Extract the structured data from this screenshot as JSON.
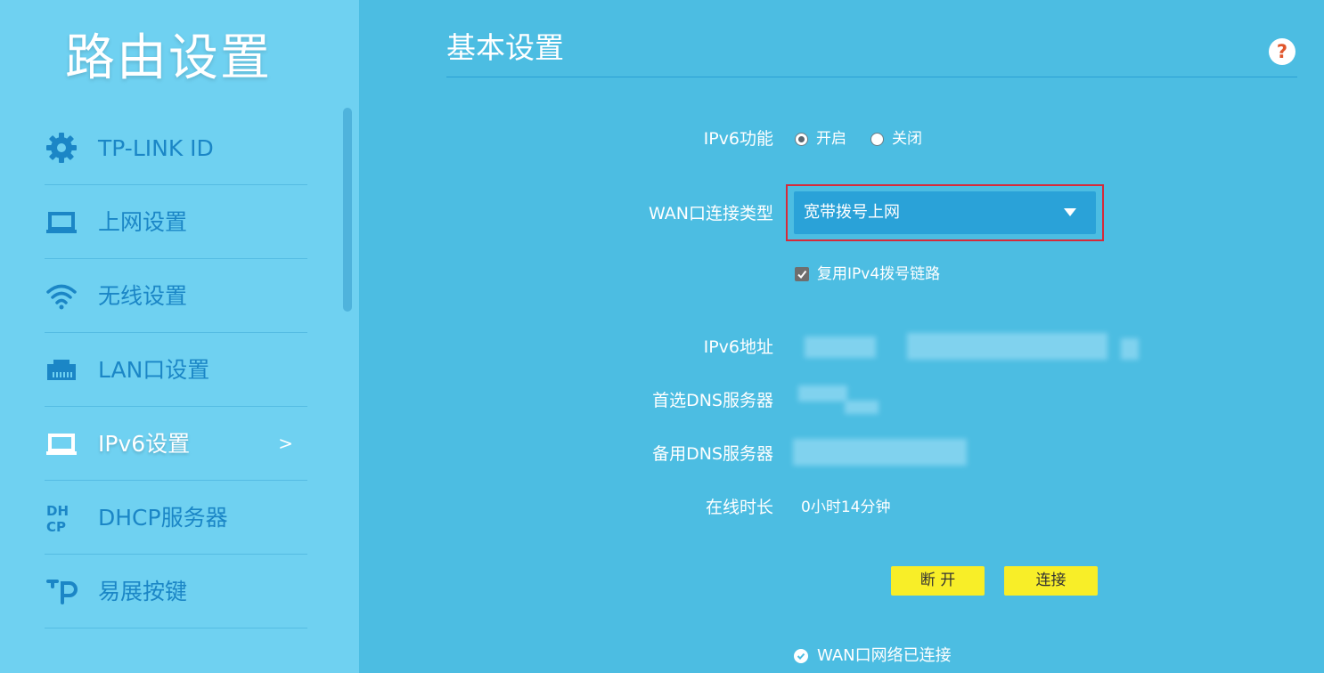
{
  "app": {
    "title": "路由设置"
  },
  "sidebar": {
    "items": [
      {
        "label": "TP-LINK ID",
        "icon": "gear-icon"
      },
      {
        "label": "上网设置",
        "icon": "laptop-icon"
      },
      {
        "label": "无线设置",
        "icon": "wifi-icon"
      },
      {
        "label": "LAN口设置",
        "icon": "ethernet-port-icon"
      },
      {
        "label": "IPv6设置",
        "icon": "laptop-icon",
        "active": true,
        "arrow": ">"
      },
      {
        "label": "DHCP服务器",
        "icon": "dhcp-icon"
      },
      {
        "label": "易展按键",
        "icon": "tp-mesh-icon"
      }
    ]
  },
  "main": {
    "title": "基本设置",
    "help_icon": "question-icon",
    "ipv6_function": {
      "label": "IPv6功能",
      "options": [
        {
          "label": "开启",
          "selected": true
        },
        {
          "label": "关闭",
          "selected": false
        }
      ]
    },
    "wan_type": {
      "label": "WAN口连接类型",
      "value": "宽带拨号上网"
    },
    "reuse_ipv4": {
      "label": "复用IPv4拨号链路",
      "checked": true
    },
    "ipv6_address": {
      "label": "IPv6地址"
    },
    "primary_dns": {
      "label": "首选DNS服务器"
    },
    "secondary_dns": {
      "label": "备用DNS服务器"
    },
    "online_time": {
      "label": "在线时长",
      "value": "0小时14分钟"
    },
    "buttons": {
      "disconnect": "断 开",
      "connect": "连接"
    },
    "status": {
      "text": "WAN口网络已连接"
    }
  },
  "colors": {
    "sidebar_bg": "#6fd1f1",
    "main_bg": "#4cbde2",
    "nav_text": "#1b86c6",
    "button_yellow": "#f8ee28",
    "highlight_red": "#d62a3a",
    "help_orange": "#e0562c"
  }
}
